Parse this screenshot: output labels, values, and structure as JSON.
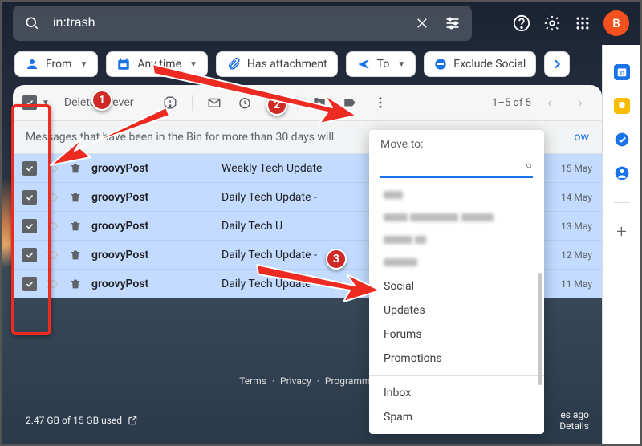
{
  "search": {
    "value": "in:trash"
  },
  "avatar": {
    "letter": "B"
  },
  "chips": {
    "from": "From",
    "anytime": "Any time",
    "attachment": "Has attachment",
    "to": "To",
    "exclude": "Exclude Social"
  },
  "toolbar": {
    "delete_label": "Delete forever",
    "pager_text": "1–5 of 5"
  },
  "banner": {
    "text": "Messages that have been in the Bin for more than 30 days will",
    "link": "ow"
  },
  "rows": [
    {
      "sender": "groovyPost",
      "subject": "Weekly Tech Update",
      "date": "15 May"
    },
    {
      "sender": "groovyPost",
      "subject": "Daily Tech Update -",
      "date": "14 May"
    },
    {
      "sender": "groovyPost",
      "subject": "Daily Tech U",
      "date": "13 May"
    },
    {
      "sender": "groovyPost",
      "subject": "Daily Tech Update -",
      "date": "12 May"
    },
    {
      "sender": "groovyPost",
      "subject": "Daily Tech Update -",
      "date": "11 May"
    }
  ],
  "popover": {
    "title": "Move to:",
    "items": [
      "Social",
      "Updates",
      "Forums",
      "Promotions"
    ],
    "bottom": [
      "Inbox",
      "Spam"
    ]
  },
  "footer": {
    "links": [
      "Terms",
      "Privacy",
      "Programme"
    ],
    "storage": "2.47 GB of 15 GB used",
    "right1": "es ago",
    "right2": "Details"
  },
  "markers": {
    "m1": "1",
    "m2": "2",
    "m3": "3"
  }
}
